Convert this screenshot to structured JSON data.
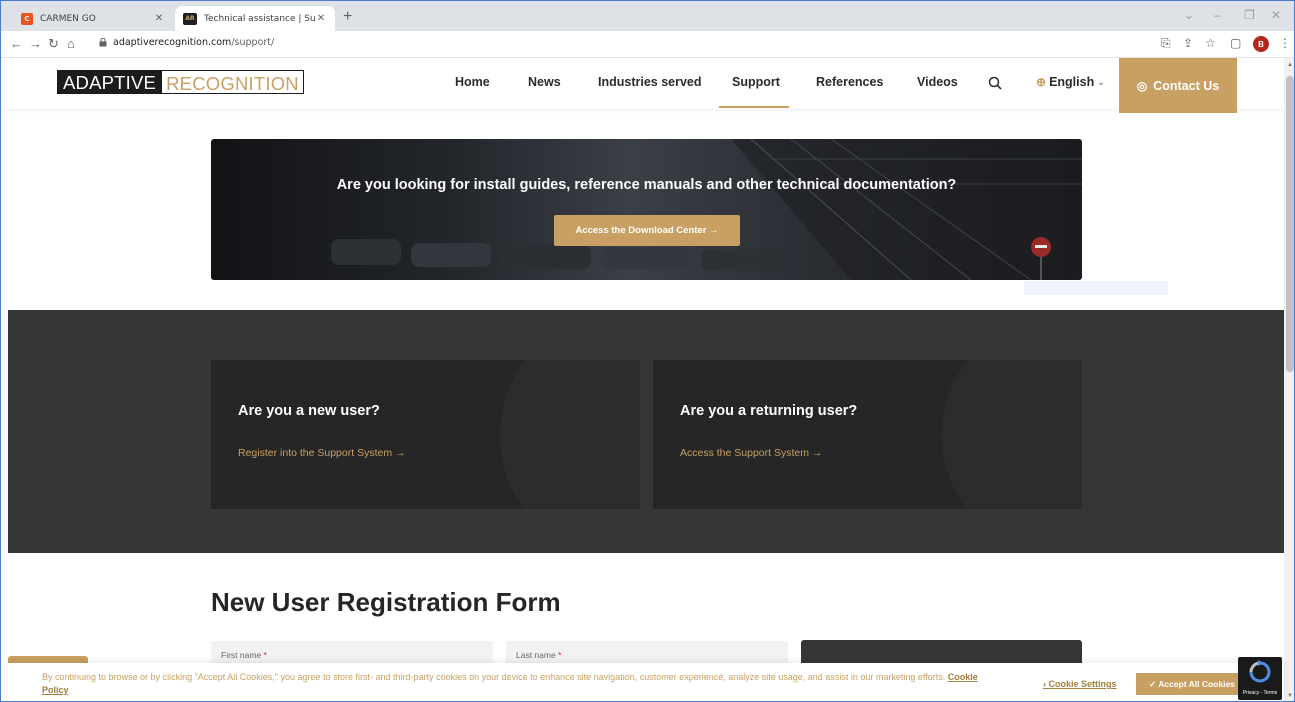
{
  "browser": {
    "tabs": [
      {
        "title": "CARMEN GO",
        "favicon": "carmen-logo-icon"
      },
      {
        "title": "Technical assistance | Support se",
        "favicon": "ar-logo-icon"
      }
    ],
    "url_domain": "adaptiverecognition.com",
    "url_path": "/support/",
    "profile_initial": "B"
  },
  "site": {
    "logo_part1": "ADAPTIVE",
    "logo_part2": "RECOGNITION",
    "nav": [
      "Home",
      "News",
      "Industries served",
      "Support",
      "References",
      "Videos"
    ],
    "active_nav": "Support",
    "language": "English",
    "contact_label": "Contact Us"
  },
  "hero": {
    "title": "Are you looking for install guides, reference manuals and other technical documentation?",
    "button_label": "Access the Download Center →"
  },
  "cards": [
    {
      "title": "Are you a new user?",
      "link": "Register into the Support System →"
    },
    {
      "title": "Are you a returning user?",
      "link": "Access the Support System →"
    }
  ],
  "form": {
    "title": "New User Registration Form",
    "first_name_label": "First name",
    "last_name_label": "Last name",
    "required_mark": "*"
  },
  "cookie": {
    "text": "By continuing to browse or by clicking \"Accept All Cookies,\" you agree to store first- and third-party cookies on your device to enhance site navigation, customer experience, analyze site usage, and assist in our marketing efforts.",
    "policy_label": "Cookie Policy",
    "settings_label": "› Cookie Settings",
    "accept_label": "✓ Accept All Cookies"
  },
  "recaptcha": {
    "label": "Privacy - Terms"
  },
  "colors": {
    "accent": "#c9a063",
    "dark": "#363636",
    "card": "#262626"
  }
}
